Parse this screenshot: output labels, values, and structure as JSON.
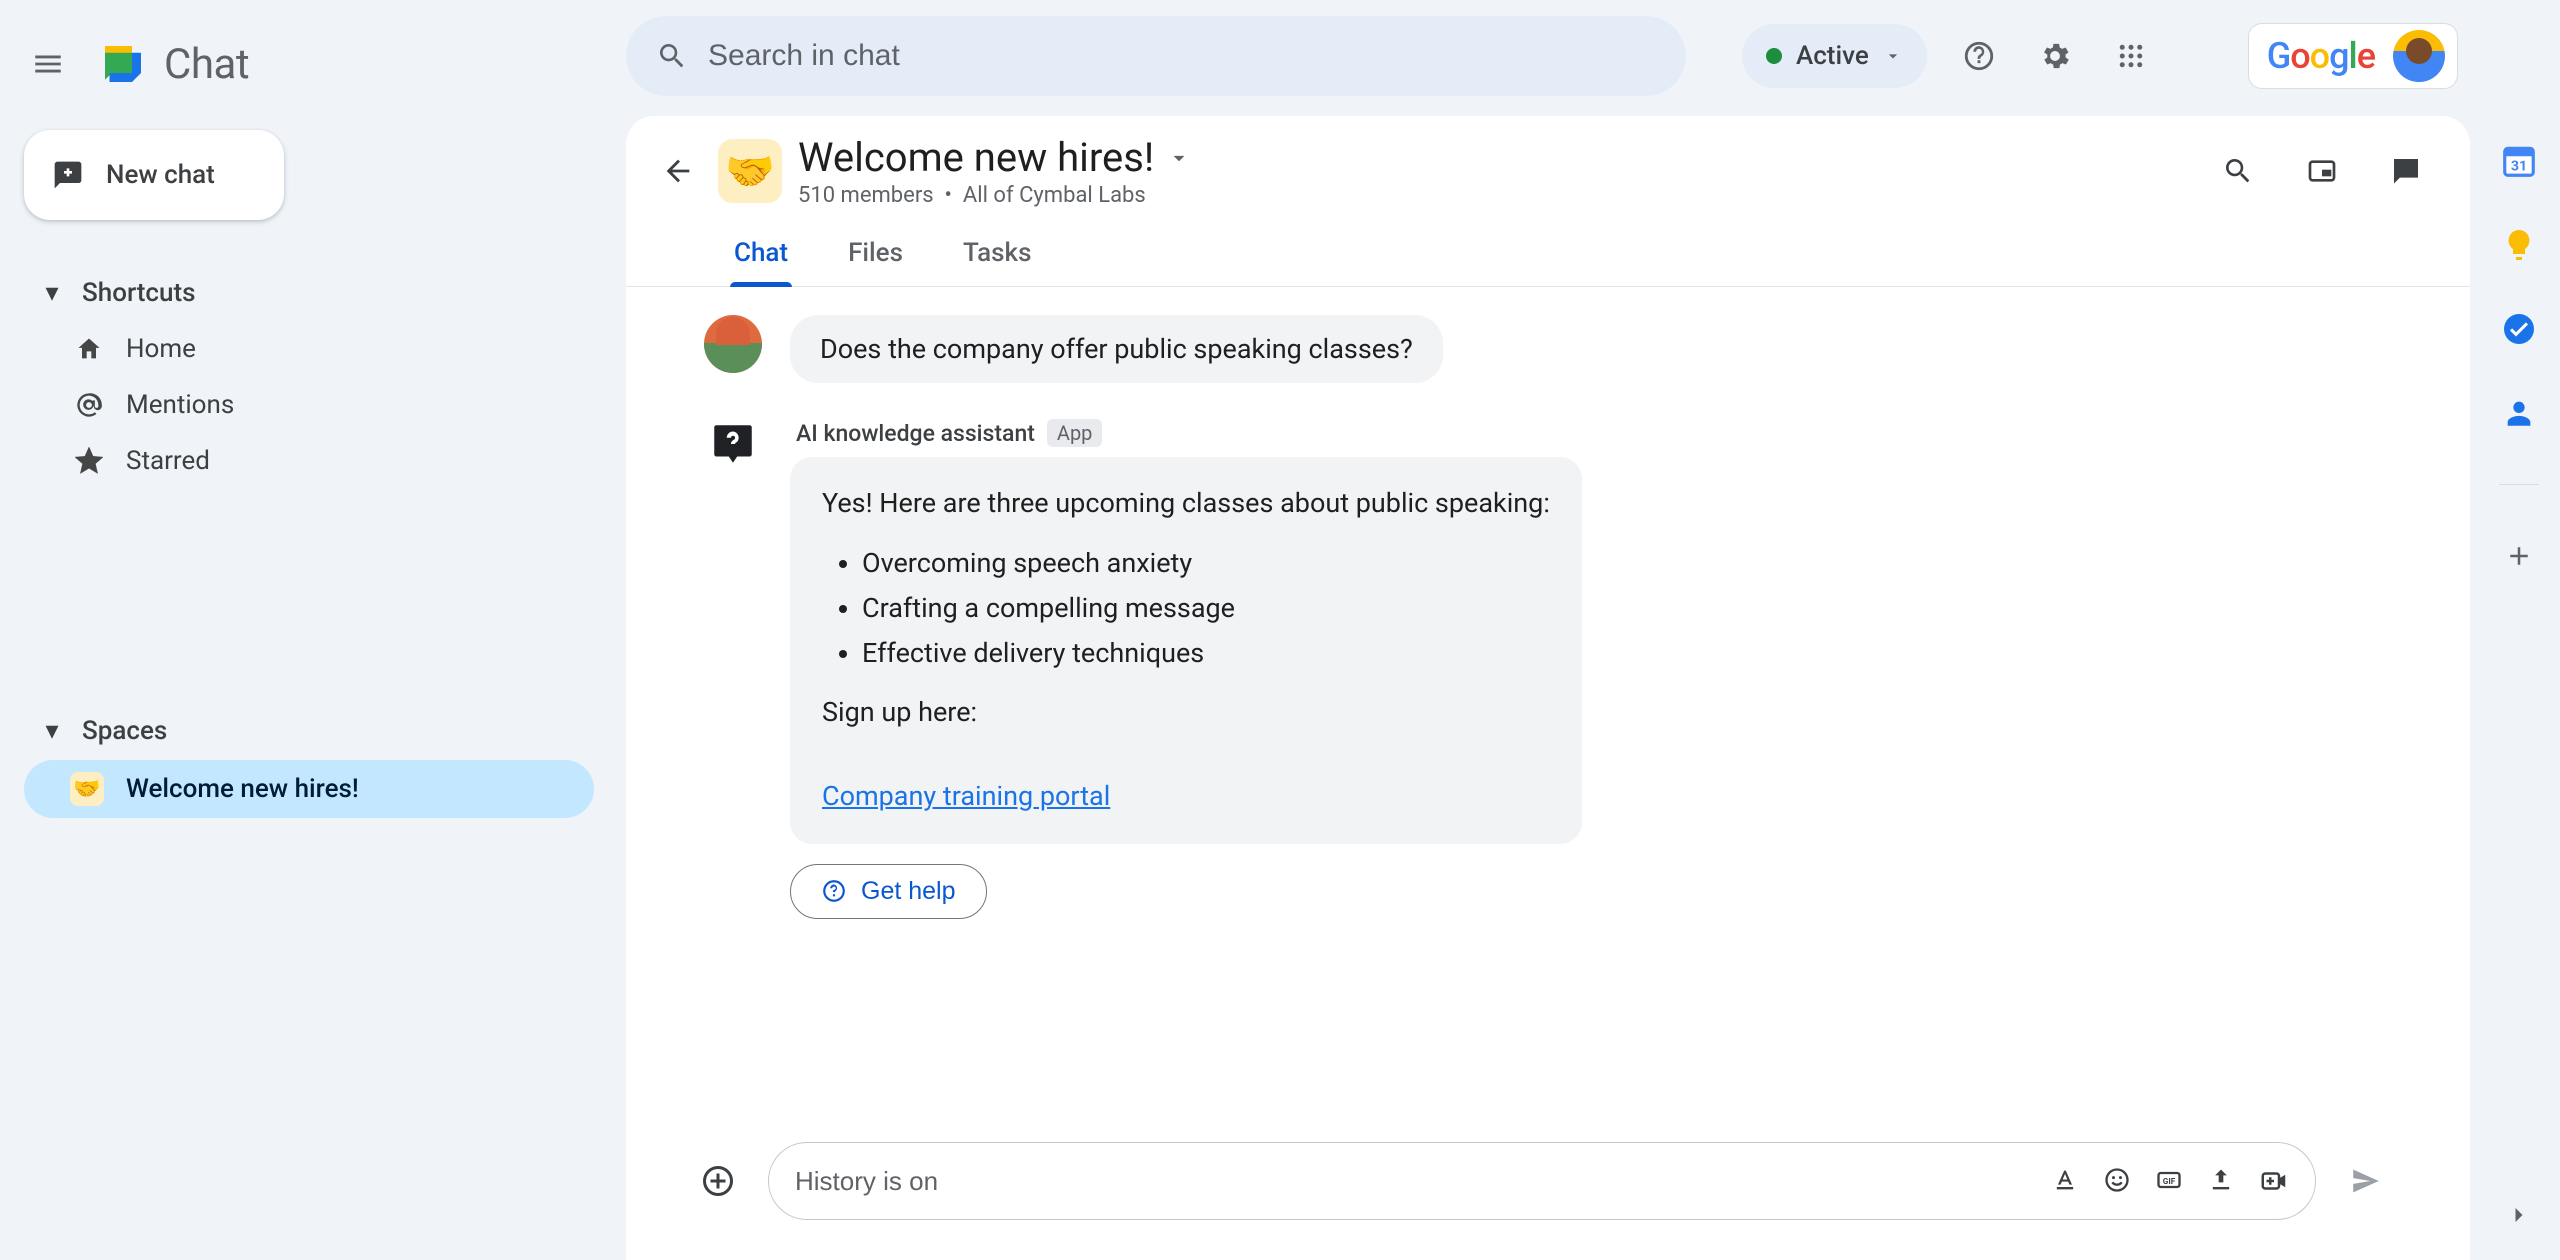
{
  "app": {
    "name": "Chat"
  },
  "search": {
    "placeholder": "Search in chat"
  },
  "status": {
    "label": "Active"
  },
  "new_chat": {
    "label": "New chat"
  },
  "sidebar": {
    "shortcuts_header": "Shortcuts",
    "items": [
      {
        "icon": "home",
        "label": "Home"
      },
      {
        "icon": "mentions",
        "label": "Mentions"
      },
      {
        "icon": "starred",
        "label": "Starred"
      }
    ],
    "spaces_header": "Spaces",
    "spaces": [
      {
        "emoji": "🤝",
        "label": "Welcome new hires!",
        "active": true
      }
    ]
  },
  "room": {
    "emoji": "🤝",
    "title": "Welcome new hires!",
    "member_count": "510 members",
    "org": "All of Cymbal Labs",
    "tabs": [
      "Chat",
      "Files",
      "Tasks"
    ],
    "active_tab": 0
  },
  "messages": {
    "user_question": "Does the company offer public speaking classes?",
    "bot": {
      "name": "AI knowledge assistant",
      "badge": "App",
      "intro": "Yes! Here are three upcoming classes about public speaking:",
      "bullets": [
        "Overcoming speech anxiety",
        "Crafting a compelling message",
        "Effective delivery techniques"
      ],
      "signup_label": "Sign up here:",
      "link_text": "Company training portal",
      "get_help": "Get help"
    }
  },
  "compose": {
    "placeholder": "History is on"
  },
  "google": {
    "letters": [
      "G",
      "o",
      "o",
      "g",
      "l",
      "e"
    ]
  }
}
